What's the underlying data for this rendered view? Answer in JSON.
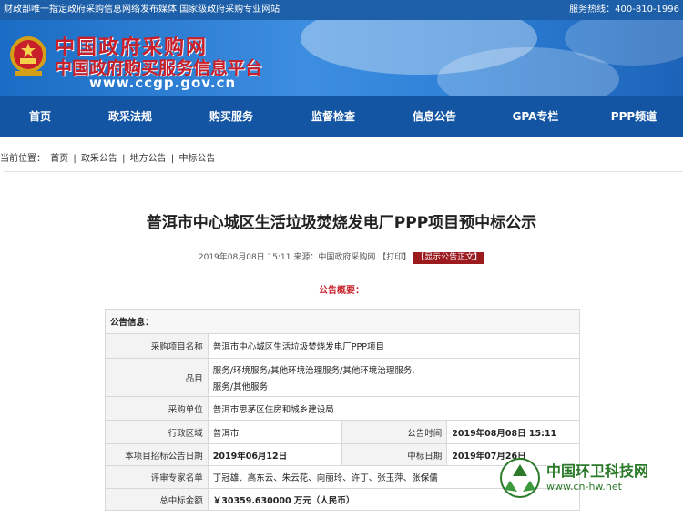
{
  "topbar": {
    "left_text": "财政部唯一指定政府采购信息网络发布媒体 国家级政府采购专业网站",
    "hotline": "服务热线：400-810-1996"
  },
  "banner": {
    "site_name": "中国政府采购网",
    "site_subtitle": "中国政府购买服务信息平台",
    "site_url": "www.ccgp.gov.cn"
  },
  "nav": {
    "items": [
      "首页",
      "政采法规",
      "购买服务",
      "监督检查",
      "信息公告",
      "GPA专栏",
      "PPP频道"
    ]
  },
  "breadcrumb": {
    "prefix": "当前位置：",
    "items": [
      "首页",
      "政采公告",
      "地方公告",
      "中标公告"
    ],
    "separator": "|"
  },
  "article": {
    "title": "普洱市中心城区生活垃圾焚烧发电厂PPP项目预中标公示",
    "meta": "2019年08月08日 15:11 来源：中国政府采购网 【打印】",
    "show_body_tag": "【显示公告正文】",
    "summary_heading": "公告概要："
  },
  "info_table": {
    "section_label": "公告信息：",
    "project_name_label": "采购项目名称",
    "project_name": "普洱市中心城区生活垃圾焚烧发电厂PPP项目",
    "category_label": "品目",
    "category_line1": "服务/环境服务/其他环境治理服务/其他环境治理服务,",
    "category_line2": "服务/其他服务",
    "purchaser_label": "采购单位",
    "purchaser": "普洱市思茅区住房和城乡建设局",
    "region_label": "行政区域",
    "region": "普洱市",
    "publish_time_label": "公告时间",
    "publish_time": "2019年08月08日 15:11",
    "bid_date_label": "本项目招标公告日期",
    "bid_date": "2019年06月12日",
    "award_date_label": "中标日期",
    "award_date": "2019年07月26日",
    "experts_label": "评审专家名单",
    "experts": "丁冠雄、高东云、朱云花、向丽玲、许丁、张玉萍、张保儒",
    "amount_label": "总中标金额",
    "amount": "￥30359.630000 万元（人民币）"
  },
  "watermark": {
    "name": "中国环卫科技网",
    "url": "www.cn-hw.net"
  },
  "colors": {
    "topbar": "#1d5fa8",
    "nav": "#1355a3",
    "accent_red": "#c8202a",
    "tag_bg": "#9b1b1f",
    "watermark_green": "#2a7a2a"
  }
}
